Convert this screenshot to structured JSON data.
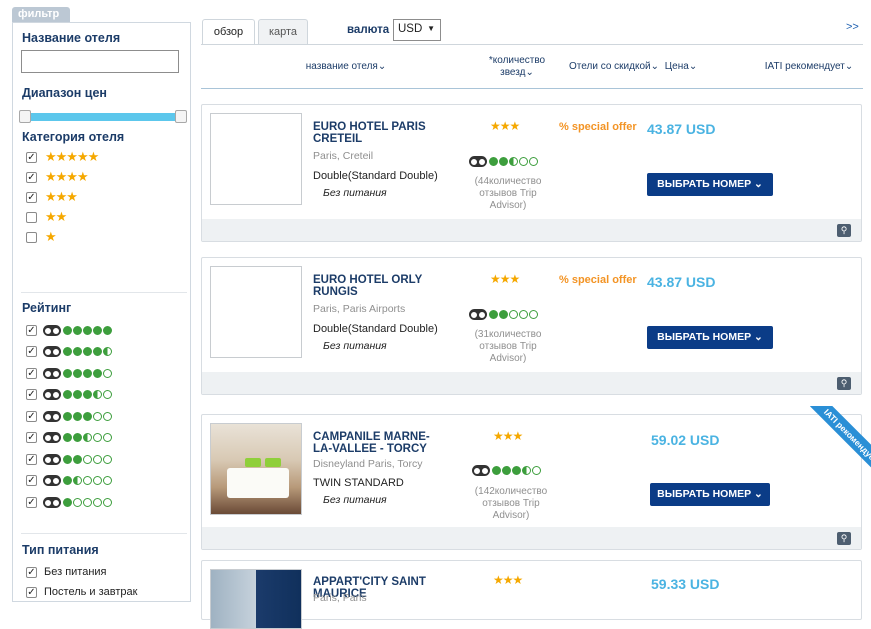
{
  "filter": {
    "tab_label": "фильтр",
    "hotel_name_title": "Название отеля",
    "hotel_name_value": "",
    "price_range_title": "Диапазон цен",
    "category_title": "Категория отеля",
    "categories": [
      {
        "stars": "★★★★★",
        "checked": true
      },
      {
        "stars": "★★★★",
        "checked": true
      },
      {
        "stars": "★★★",
        "checked": true
      },
      {
        "stars": "★★",
        "checked": false
      },
      {
        "stars": "★",
        "checked": false
      }
    ],
    "rating_title": "Рейтинг",
    "ratings": [
      5,
      4.5,
      4,
      3.5,
      3,
      2.5,
      2,
      1.5,
      1
    ],
    "meal_title": "Тип питания",
    "meals": [
      {
        "label": "Без питания",
        "checked": true
      },
      {
        "label": "Постель и завтрак",
        "checked": true
      }
    ]
  },
  "header": {
    "tabs": [
      "обзор",
      "карта"
    ],
    "currency_label": "валюта",
    "currency_value": "USD",
    "more_link": ">>",
    "columns": {
      "name": "название отеля⌄",
      "stars": "*количество звезд⌄",
      "discount": "Отели со скидкой⌄",
      "price": "Цена⌄",
      "recommend": "IATI рекомендует⌄"
    }
  },
  "hotels": [
    {
      "name": "EURO HOTEL PARIS CRETEIL",
      "location": "Paris, Creteil",
      "room": "Double(Standard Double)",
      "meal": "Без питания",
      "stars": "★★★",
      "rating": 2.5,
      "reviews": "(44количество отзывов Trip Advisor)",
      "offer": "%  special offer",
      "price": "43.87 USD",
      "button": "ВЫБРАТЬ НОМЕР ⌄",
      "zoom_icon": "magnifier-icon"
    },
    {
      "name": "EURO HOTEL ORLY RUNGIS",
      "location": "Paris, Paris Airports",
      "room": "Double(Standard Double)",
      "meal": "Без питания",
      "stars": "★★★",
      "rating": 2,
      "reviews": "(31количество отзывов Trip Advisor)",
      "offer": "%  special offer",
      "price": "43.87 USD",
      "button": "ВЫБРАТЬ НОМЕР ⌄",
      "zoom_icon": "magnifier-icon"
    },
    {
      "name": "CAMPANILE MARNE-LA-VALLEE - TORCY",
      "location": "Disneyland Paris, Torcy",
      "room": "TWIN STANDARD",
      "meal": "Без питания",
      "stars": "★★★",
      "rating": 3.5,
      "reviews": "(142количество отзывов Trip Advisor)",
      "price": "59.02 USD",
      "button": "ВЫБРАТЬ НОМЕР ⌄",
      "ribbon": "IATI рекомендует",
      "zoom_icon": "magnifier-icon"
    },
    {
      "name": "APPART'CITY SAINT MAURICE",
      "location": "Paris, Paris",
      "stars": "★★★",
      "price": "59.33 USD"
    }
  ],
  "colors": {
    "accent_blue": "#0b3c87",
    "price_blue": "#4ab3e2",
    "offer_orange": "#f39425",
    "star": "#f5a800",
    "bubble_green": "#3d9e3d"
  }
}
